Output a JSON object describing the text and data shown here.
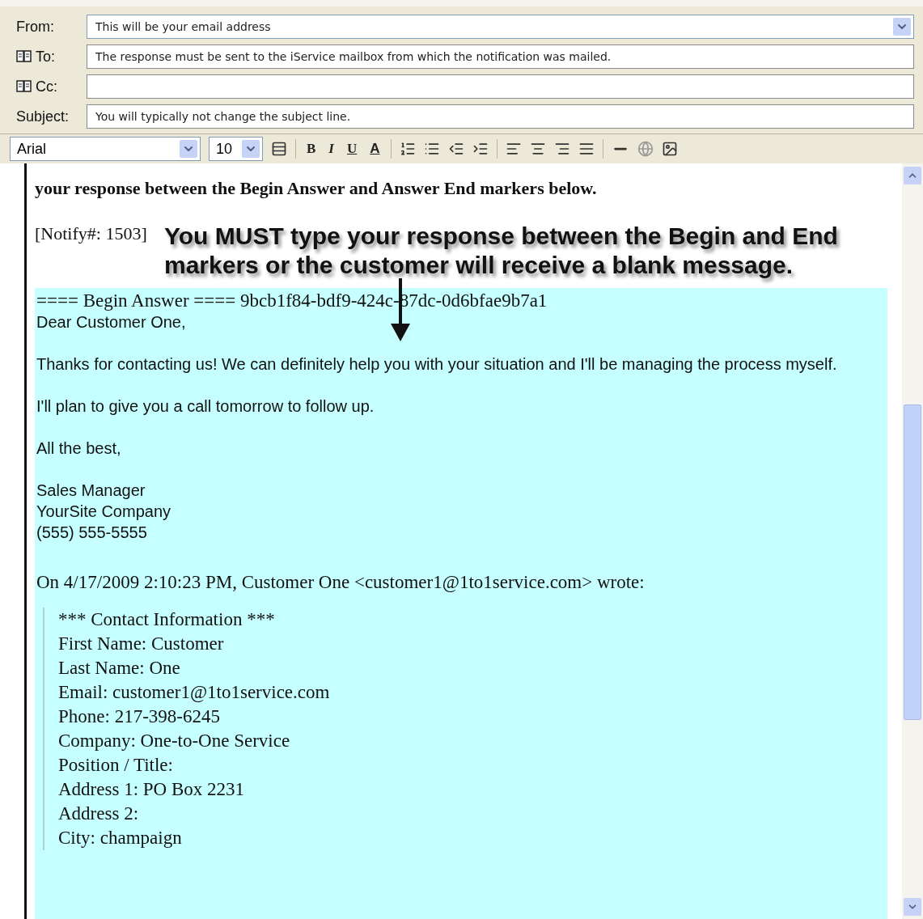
{
  "header": {
    "fields": [
      {
        "label": "From:",
        "kind": "dropdown",
        "address_book": false,
        "value": "This will be your email address"
      },
      {
        "label": "To:",
        "kind": "text",
        "address_book": true,
        "value": "The response must be sent to the iService mailbox from which the notification was mailed."
      },
      {
        "label": "Cc:",
        "kind": "text",
        "address_book": true
      },
      {
        "label": "Subject:",
        "kind": "text",
        "address_book": false,
        "value": "You will typically not change the subject line."
      }
    ]
  },
  "toolbar": {
    "font": "Arial",
    "size": "10",
    "format_buttons": [
      {
        "label": "B",
        "kind": "bold"
      },
      {
        "label": "I",
        "kind": "italic"
      },
      {
        "label": "U",
        "kind": "underline"
      },
      {
        "label": "A",
        "kind": "color"
      }
    ]
  },
  "body": {
    "instruction": "your response between the Begin Answer and Answer End markers below.",
    "notify": "[Notify#: 1503]",
    "annotation": "You MUST type your response between the Begin and End markers or the customer will receive a blank message.",
    "begin_marker": "==== Begin Answer ==== 9bcb1f84-bdf9-424c-87dc-0d6bfae9b7a1",
    "answer_paragraphs": [
      [
        "Dear Customer One,"
      ],
      [
        "Thanks for contacting us! We can definitely help you with your situation and I'll be managing the process myself."
      ],
      [
        "I'll plan to give you a call tomorrow to follow up."
      ],
      [
        "All the best,"
      ],
      [
        "Sales Manager",
        "YourSite Company",
        "(555) 555-5555"
      ]
    ],
    "quote_header": "On 4/17/2009 2:10:23 PM, Customer One <customer1@1to1service.com> wrote:",
    "quoted_lines": [
      "*** Contact Information ***",
      "First Name: Customer",
      "Last Name: One",
      "Email: customer1@1to1service.com",
      "Phone: 217-398-6245",
      "Company: One-to-One Service",
      "Position / Title:",
      "Address 1: PO Box 2231",
      "Address 2:",
      "City: champaign"
    ]
  }
}
